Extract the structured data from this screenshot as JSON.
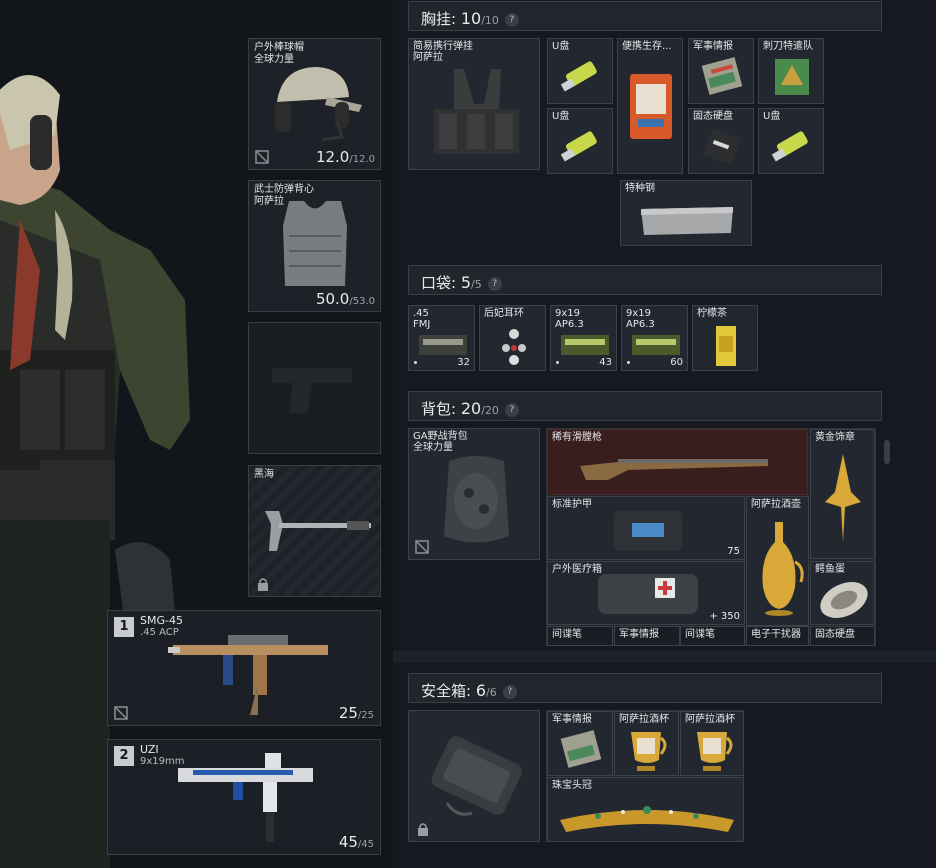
{
  "equipment": {
    "helmet": {
      "name": "户外棒球帽\n全球力量",
      "dur": "12.0",
      "dur_max": "/12.0"
    },
    "armor": {
      "name": "武士防弹背心\n阿萨拉",
      "dur": "50.0",
      "dur_max": "/53.0"
    },
    "melee": {
      "name": "黑海"
    }
  },
  "weapons": [
    {
      "num": "1",
      "name": "SMG-45",
      "caliber": ".45 ACP",
      "ammo": "25",
      "ammo_max": "/25"
    },
    {
      "num": "2",
      "name": "UZI",
      "caliber": "9x19mm",
      "ammo": "45",
      "ammo_max": "/45"
    }
  ],
  "chest_rig": {
    "title": "胸挂:",
    "count": "10",
    "max": "/10",
    "help": "?",
    "rig_name": "简易携行弹挂\n阿萨拉",
    "items": [
      "U盘",
      "便携生存...",
      "军事情报",
      "刺刀特遣队",
      "U盘",
      "固态硬盘",
      "U盘",
      "特种钢"
    ]
  },
  "pockets": {
    "title": "口袋:",
    "count": "5",
    "max": "/5",
    "help": "?",
    "items": [
      {
        "label": ".45\nFMJ",
        "count": "32"
      },
      {
        "label": "后妃耳环",
        "count": ""
      },
      {
        "label": "9x19\nAP6.3",
        "count": "43"
      },
      {
        "label": "9x19\nAP6.3",
        "count": "60"
      },
      {
        "label": "柠檬茶",
        "count": ""
      }
    ]
  },
  "backpack": {
    "title": "背包:",
    "count": "20",
    "max": "/20",
    "help": "?",
    "bag_name": "GA野战背包\n全球力量",
    "items": [
      {
        "label": "稀有滑膛枪",
        "count": ""
      },
      {
        "label": "黄金饰章",
        "count": ""
      },
      {
        "label": "标准护甲",
        "count": "75"
      },
      {
        "label": "阿萨拉酒壶",
        "count": ""
      },
      {
        "label": "户外医疗箱",
        "count": "+ 350"
      },
      {
        "label": "鳄鱼蛋",
        "count": ""
      },
      {
        "label": "间谍笔",
        "count": ""
      },
      {
        "label": "军事情报",
        "count": ""
      },
      {
        "label": "间谍笔",
        "count": ""
      },
      {
        "label": "电子干扰器",
        "count": ""
      },
      {
        "label": "固态硬盘",
        "count": ""
      }
    ]
  },
  "safe_box": {
    "title": "安全箱:",
    "count": "6",
    "max": "/6",
    "help": "?",
    "items": [
      "军事情报",
      "阿萨拉酒杯",
      "阿萨拉酒杯",
      "珠宝头冠"
    ]
  }
}
